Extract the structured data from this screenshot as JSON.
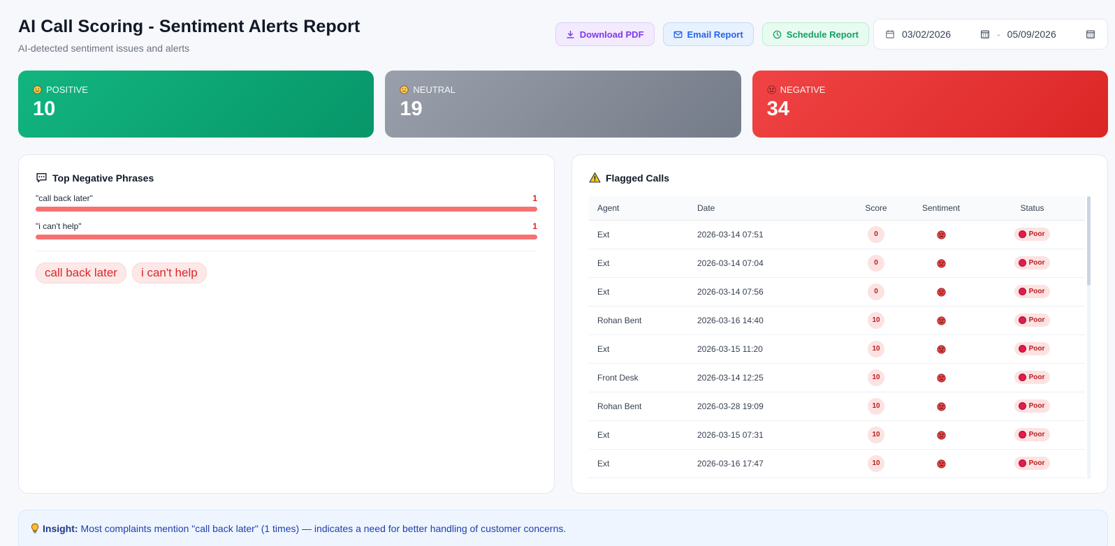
{
  "header": {
    "title": "AI Call Scoring - Sentiment Alerts Report",
    "subtitle": "AI-detected sentiment issues and alerts"
  },
  "actions": {
    "download_pdf": "Download PDF",
    "email_report": "Email Report",
    "schedule_report": "Schedule Report"
  },
  "date_range": {
    "from": "03/02/2026",
    "separator": "-",
    "to": "05/09/2026"
  },
  "cards": [
    {
      "label": "POSITIVE",
      "value": "10",
      "icon": "smile-icon",
      "color": "#10b981"
    },
    {
      "label": "NEUTRAL",
      "value": "19",
      "icon": "neutral-face-icon",
      "color": "#6b7280"
    },
    {
      "label": "NEGATIVE",
      "value": "34",
      "icon": "angry-face-icon",
      "color": "#ef4444"
    }
  ],
  "phrases_panel": {
    "title": "Top Negative Phrases",
    "phrases": [
      {
        "text": "\"call back later\"",
        "count": "1",
        "fill": 1.0
      },
      {
        "text": "\"i can't help\"",
        "count": "1",
        "fill": 1.0
      }
    ],
    "tags": [
      "call back later",
      "i can't help"
    ]
  },
  "flagged_panel": {
    "title": "Flagged Calls",
    "columns": [
      "Agent",
      "Date",
      "Score",
      "Sentiment",
      "Status"
    ],
    "rows": [
      {
        "agent": "Ext",
        "date": "2026-03-14 07:51",
        "score": "0",
        "sentiment": "angry-face-icon",
        "status": "Poor"
      },
      {
        "agent": "Ext",
        "date": "2026-03-14 07:04",
        "score": "0",
        "sentiment": "angry-face-icon",
        "status": "Poor"
      },
      {
        "agent": "Ext",
        "date": "2026-03-14 07:56",
        "score": "0",
        "sentiment": "angry-face-icon",
        "status": "Poor"
      },
      {
        "agent": "Rohan Bent",
        "date": "2026-03-16 14:40",
        "score": "10",
        "sentiment": "angry-face-icon",
        "status": "Poor"
      },
      {
        "agent": "Ext",
        "date": "2026-03-15 11:20",
        "score": "10",
        "sentiment": "angry-face-icon",
        "status": "Poor"
      },
      {
        "agent": "Front Desk",
        "date": "2026-03-14 12:25",
        "score": "10",
        "sentiment": "angry-face-icon",
        "status": "Poor"
      },
      {
        "agent": "Rohan Bent",
        "date": "2026-03-28 19:09",
        "score": "10",
        "sentiment": "angry-face-icon",
        "status": "Poor"
      },
      {
        "agent": "Ext",
        "date": "2026-03-15 07:31",
        "score": "10",
        "sentiment": "angry-face-icon",
        "status": "Poor"
      },
      {
        "agent": "Ext",
        "date": "2026-03-16 17:47",
        "score": "10",
        "sentiment": "angry-face-icon",
        "status": "Poor"
      }
    ]
  },
  "insight": {
    "label": "Insight:",
    "text": "Most complaints mention \"call back later\" (1 times) — indicates a need for better handling of customer concerns."
  }
}
